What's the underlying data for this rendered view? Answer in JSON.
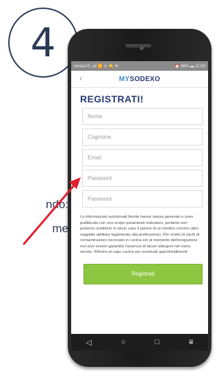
{
  "step": {
    "number": "4"
  },
  "annotation": {
    "line1": "ndo:",
    "line2": "me",
    "arrow_color": "#e02030"
  },
  "status_bar": {
    "left": "Iontact E..ull 🛜 ⊙ 🔔 ✉",
    "right": "⏰ 96% ▬ 11:00"
  },
  "app_bar": {
    "back_icon": "back-chevron-icon",
    "logo_prefix": "MY",
    "logo_suffix": "SODEXO"
  },
  "page": {
    "title": "REGISTRATI!"
  },
  "form": {
    "fields": [
      {
        "placeholder": "Nome"
      },
      {
        "placeholder": "Cognome"
      },
      {
        "placeholder": "Email"
      },
      {
        "placeholder": "Password"
      },
      {
        "placeholder": "Password"
      }
    ]
  },
  "disclaimer": "Le informazioni nutrizionali fornite hanno natura generale e sono pubblicate con uno scopo puramente indicativo, pertanto non possono sostituire in alcun caso il parere di un medico (ovvero altro soggetto abilitato legalmente alla professione). Per motivi di rischi di contaminazioni incrociate in cucina e/o al momento dell'erogazione non può essere garantita l'assenza di alcuni allergeni nel menu servito. Riferirsi al capo cucina per eventuali approfondimenti.",
  "submit": {
    "label": "Registrati"
  },
  "nav_bar": {
    "back": "◁",
    "home": "○",
    "recents": "□",
    "menu": "⩸"
  },
  "colors": {
    "brand_navy": "#253a76",
    "accent_green": "#8dc640",
    "logo_blue": "#3c87c8"
  }
}
